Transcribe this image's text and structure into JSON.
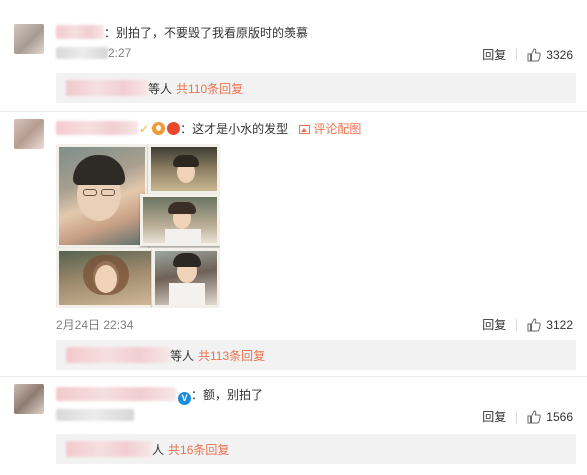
{
  "comments": [
    {
      "text": "：别拍了，不要毁了我看原版时的羡慕",
      "date_visible": "2:27",
      "reply_label": "回复",
      "likes": "3326",
      "sub_replies": {
        "who_suffix": "等人",
        "count_text": "共110条回复"
      }
    },
    {
      "text": "：这才是小水的发型",
      "pic_link": "评论配图",
      "date": "2月24日 22:34",
      "reply_label": "回复",
      "likes": "3122",
      "sub_replies": {
        "who_suffix": "等人",
        "count_text": "共113条回复"
      }
    },
    {
      "text": "：额，别拍了",
      "reply_label": "回复",
      "likes": "1566",
      "sub_replies": {
        "who_suffix": "人",
        "count_text": "共16条回复"
      }
    }
  ],
  "colors": {
    "accent": "#eb7350",
    "muted": "#808080",
    "reply_bg": "#f2f2f2"
  },
  "icons": [
    "thumbs-up-icon",
    "image-icon",
    "verified-badge-icon"
  ]
}
